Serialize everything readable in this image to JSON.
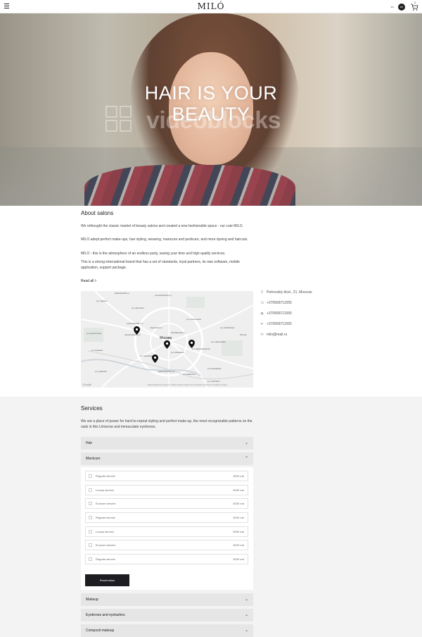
{
  "header": {
    "logo": "MILÓ",
    "lang_ru": "ru",
    "lang_en": "en",
    "cart_count": "2"
  },
  "hero": {
    "title_line1": "HAIR IS YOUR",
    "title_line2": "BEAUTY",
    "watermark": "videoblocks"
  },
  "about": {
    "title": "About salons",
    "paragraphs": [
      "We rethought the classic market of beauty salons and created a new fashionable space - our cute MILO.",
      "MILO adept perfect make-ups, hair styling, weaving, manicure and pedicure, and more dyeing and haircuts.",
      "MILO - this is the atmosphere of an endless party, saving your time and high quality services.",
      "This is a strong international brand that has a set of standards, loyal partners, its own software, mobile application, support package."
    ],
    "read_all": "Read all",
    "read_all_arrow": "›"
  },
  "map": {
    "labels": {
      "l1": "войковский р-н",
      "l2": "останкинский р-н",
      "l3": "р-н аэропорт",
      "l4": "р-н сокольники",
      "l5": "тверской р-н",
      "l6": "басманный р-н",
      "l7": "Москва",
      "l8": "р-н хамовники",
      "l9": "р-н якиманка",
      "l10": "р-н замоскворечье",
      "l11": "р-н кузьминки",
      "l12": "р-н люблино",
      "l13": "р-н крылатское",
      "l14": "р-н кунцево",
      "l15": "даниловский р-н",
      "l16": "р-н нагатино",
      "l17": "р-н измайлово",
      "l18": "р-н лефортово",
      "l19": "Реутов",
      "l20": "Google",
      "l21": "р-н раменки",
      "l22": "р-н щукино",
      "l23": "пресненский р-н",
      "l24": "хорошевский р-н"
    },
    "attribution": "Картографические данные © 2018 Google   Условия использования   Сообщить об ошибке на карте"
  },
  "contacts": [
    {
      "icon": "location-icon",
      "glyph": "⚲",
      "text": "Petrovskiy blvd., 21, Moscow"
    },
    {
      "icon": "phone-icon",
      "glyph": "☏",
      "text": "+370568711555"
    },
    {
      "icon": "whatsapp-icon",
      "glyph": "◉",
      "text": "+370568711555"
    },
    {
      "icon": "telegram-icon",
      "glyph": "➤",
      "text": "+370568711555"
    },
    {
      "icon": "mail-icon",
      "glyph": "✉",
      "text": "milo@mail.ru"
    }
  ],
  "services": {
    "title": "Services",
    "intro": "We are a place of power for hard-to-repeat styling and perfect make-up, the most recognizable patterns on the nails in this Universe and immaculate eyebrows.",
    "categories": {
      "hair": "Hair",
      "manicure": "Manicure",
      "makeup": "Makeup",
      "eyebrows": "Eyebrows and eyelashes",
      "composit": "Composit makeup"
    },
    "chevron_down": "⌄",
    "chevron_up": "⌃",
    "items": [
      {
        "name": "Regular service",
        "price": "3000 rub"
      },
      {
        "name": "Luxary service",
        "price": "9000 rub"
      },
      {
        "name": "Econom service",
        "price": "3000 rub"
      },
      {
        "name": "Regular service",
        "price": "3000 rub"
      },
      {
        "name": "Luxary service",
        "price": "9000 rub"
      },
      {
        "name": "Econom service",
        "price": "3000 rub"
      },
      {
        "name": "Regular service",
        "price": "3000 rub"
      }
    ],
    "reservation": "Reservation"
  },
  "colors": {
    "accent_dark": "#1e1e22",
    "section_gray": "#f3f3f3",
    "accordion_gray": "#e6e6e6"
  }
}
